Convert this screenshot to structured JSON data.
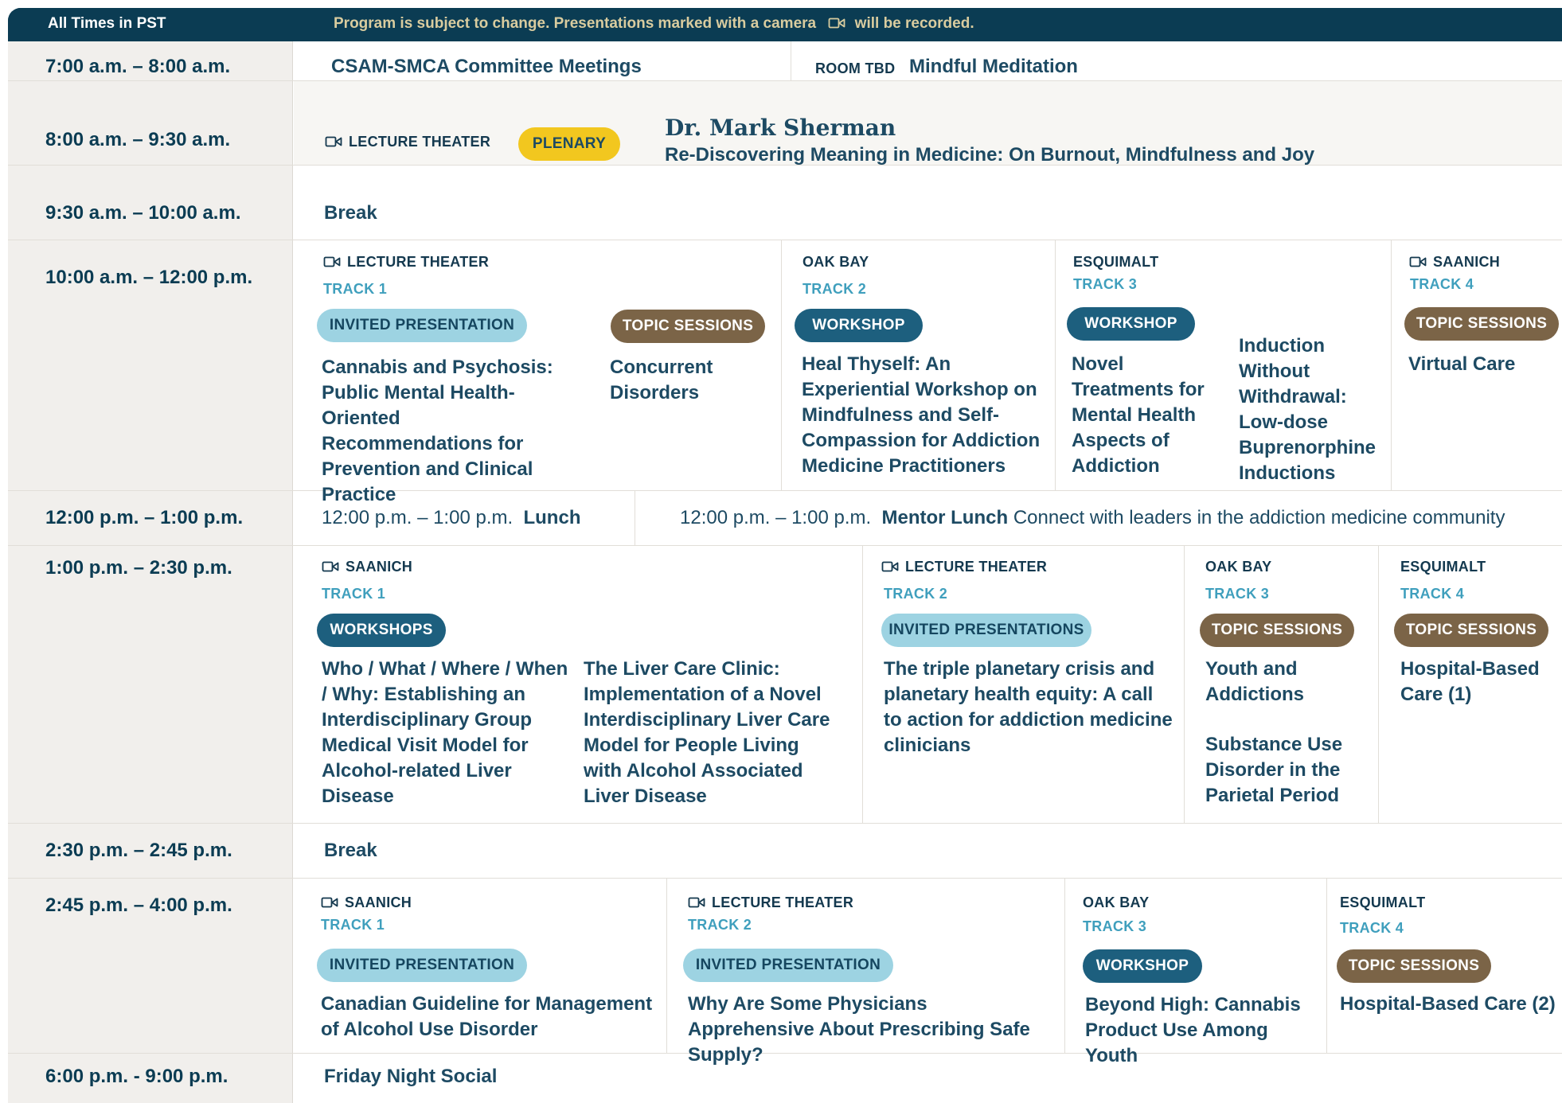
{
  "header": {
    "timezone": "All Times in PST",
    "note_before": "Program is subject to change. Presentations marked with a camera",
    "note_after": "will be recorded."
  },
  "rows": {
    "r1": {
      "time": "7:00 a.m. – 8:00 a.m.",
      "left_title": "CSAM-SMCA Committee Meetings",
      "room": "ROOM TBD",
      "right_title": "Mindful Meditation"
    },
    "r2": {
      "time": "8:00 a.m. – 9:30 a.m.",
      "room": "LECTURE THEATER",
      "badge": "PLENARY",
      "speaker": "Dr. Mark Sherman",
      "title": "Re-Discovering Meaning in Medicine: On Burnout, Mindfulness and Joy"
    },
    "r3": {
      "time": "9:30 a.m. – 10:00 a.m.",
      "title": "Break"
    },
    "r4": {
      "time": "10:00 a.m. – 12:00 p.m.",
      "c1": {
        "room": "LECTURE THEATER",
        "track": "TRACK 1",
        "badge": "INVITED PRESENTATION",
        "title": "Cannabis and Psychosis: Public Mental Health-Oriented Recommendations for Prevention and Clinical Practice",
        "badge2": "TOPIC SESSIONS",
        "title2": "Concurrent Disorders"
      },
      "c2": {
        "room": "OAK BAY",
        "track": "TRACK 2",
        "badge": "WORKSHOP",
        "title": "Heal Thyself: An Experiential Workshop on Mindfulness and Self-Compassion for Addiction Medicine Practitioners"
      },
      "c3": {
        "room": "ESQUIMALT",
        "track": "TRACK 3",
        "badge": "WORKSHOP",
        "title": "Novel Treatments for Mental Health Aspects of Addiction",
        "title2": "Induction Without Withdrawal: Low-dose Buprenorphine Inductions"
      },
      "c4": {
        "room": "SAANICH",
        "track": "TRACK 4",
        "badge": "TOPIC SESSIONS",
        "title": "Virtual Care"
      }
    },
    "r5": {
      "time": "12:00 p.m. – 1:00 p.m.",
      "left_time": "12:00 p.m. – 1:00 p.m.",
      "left_title": "Lunch",
      "right_time": "12:00 p.m. – 1:00 p.m.",
      "right_title": "Mentor Lunch",
      "right_desc": "Connect with leaders in the addiction medicine community"
    },
    "r6": {
      "time": "1:00 p.m. – 2:30 p.m.",
      "c1": {
        "room": "SAANICH",
        "track": "TRACK 1",
        "badge": "WORKSHOPS",
        "title": "Who / What / Where / When / Why: Establishing an Interdisciplinary Group Medical Visit Model for Alcohol-related Liver Disease",
        "title2": "The Liver Care Clinic: Implementation of a Novel Interdisciplinary Liver Care Model for People Living with Alcohol Associated Liver Disease"
      },
      "c2": {
        "room": "LECTURE THEATER",
        "track": "TRACK 2",
        "badge": "INVITED PRESENTATIONS",
        "title": "The triple planetary crisis and planetary health equity: A call to action for addiction medicine clinicians"
      },
      "c3": {
        "room": "OAK BAY",
        "track": "TRACK 3",
        "badge": "TOPIC SESSIONS",
        "title": "Youth and Addictions",
        "title2": "Substance Use Disorder in the Parietal Period"
      },
      "c4": {
        "room": "ESQUIMALT",
        "track": "TRACK 4",
        "badge": "TOPIC SESSIONS",
        "title": "Hospital-Based Care (1)"
      }
    },
    "r7": {
      "time": "2:30 p.m. – 2:45 p.m.",
      "title": "Break"
    },
    "r8": {
      "time": "2:45 p.m. – 4:00 p.m.",
      "c1": {
        "room": "SAANICH",
        "track": "TRACK 1",
        "badge": "INVITED PRESENTATION",
        "title": "Canadian Guideline for Management of Alcohol Use Disorder"
      },
      "c2": {
        "room": "LECTURE THEATER",
        "track": "TRACK 2",
        "badge": "INVITED PRESENTATION",
        "title": "Why Are Some Physicians Apprehensive About Prescribing Safe Supply?"
      },
      "c3": {
        "room": "OAK BAY",
        "track": "TRACK 3",
        "badge": "WORKSHOP",
        "title": "Beyond High: Cannabis Product Use Among Youth"
      },
      "c4": {
        "room": "ESQUIMALT",
        "track": "TRACK 4",
        "badge": "TOPIC SESSIONS",
        "title": "Hospital-Based Care (2)"
      }
    },
    "r9": {
      "time": "6:00 p.m. - 9:00 p.m.",
      "title": "Friday Night Social"
    }
  },
  "icons": {
    "camera": "video-camera-icon"
  },
  "colors": {
    "header_bg": "#0b3c53",
    "time_col_bg": "#f1efec",
    "track": "#3f9fbd",
    "invited": "#9dd3e2",
    "workshop": "#1d5f7e",
    "topic": "#7b6447",
    "plenary": "#f2c71f"
  }
}
